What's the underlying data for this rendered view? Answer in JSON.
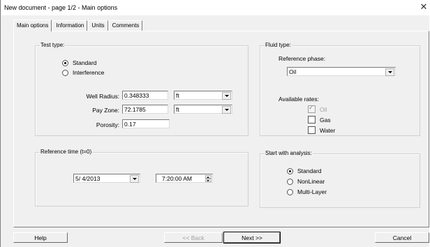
{
  "window": {
    "title": "New document - page 1/2 - Main options",
    "close_glyph": "✕"
  },
  "tabs": [
    {
      "label": "Main options",
      "active": true
    },
    {
      "label": "Information",
      "active": false
    },
    {
      "label": "Units",
      "active": false
    },
    {
      "label": "Comments",
      "active": false
    }
  ],
  "test_type": {
    "legend": "Test type:",
    "options": [
      {
        "label": "Standard",
        "selected": true
      },
      {
        "label": "Interference",
        "selected": false
      }
    ],
    "well_radius": {
      "label": "Well Radius:",
      "value": "0.348333",
      "unit": "ft"
    },
    "pay_zone": {
      "label": "Pay Zone:",
      "value": "72.1785",
      "unit": "ft"
    },
    "porosity": {
      "label": "Porosity:",
      "value": "0.17"
    }
  },
  "fluid_type": {
    "legend": "Fluid type:",
    "reference_phase_label": "Reference phase:",
    "reference_phase_value": "Oil",
    "available_rates_label": "Available rates:",
    "rates": [
      {
        "label": "Oil",
        "checked": true,
        "disabled": true
      },
      {
        "label": "Gas",
        "checked": false,
        "disabled": false
      },
      {
        "label": "Water",
        "checked": false,
        "disabled": false
      }
    ]
  },
  "reference_time": {
    "legend": "Reference time (t=0)",
    "date": "5/ 4/2013",
    "time": "7:20:00 AM"
  },
  "start_analysis": {
    "legend": "Start with analysis:",
    "options": [
      {
        "label": "Standard",
        "selected": true
      },
      {
        "label": "NonLinear",
        "selected": false
      },
      {
        "label": "Multi-Layer",
        "selected": false
      }
    ]
  },
  "buttons": {
    "help": "Help",
    "back": "<< Back",
    "next": "Next >>",
    "cancel": "Cancel"
  }
}
